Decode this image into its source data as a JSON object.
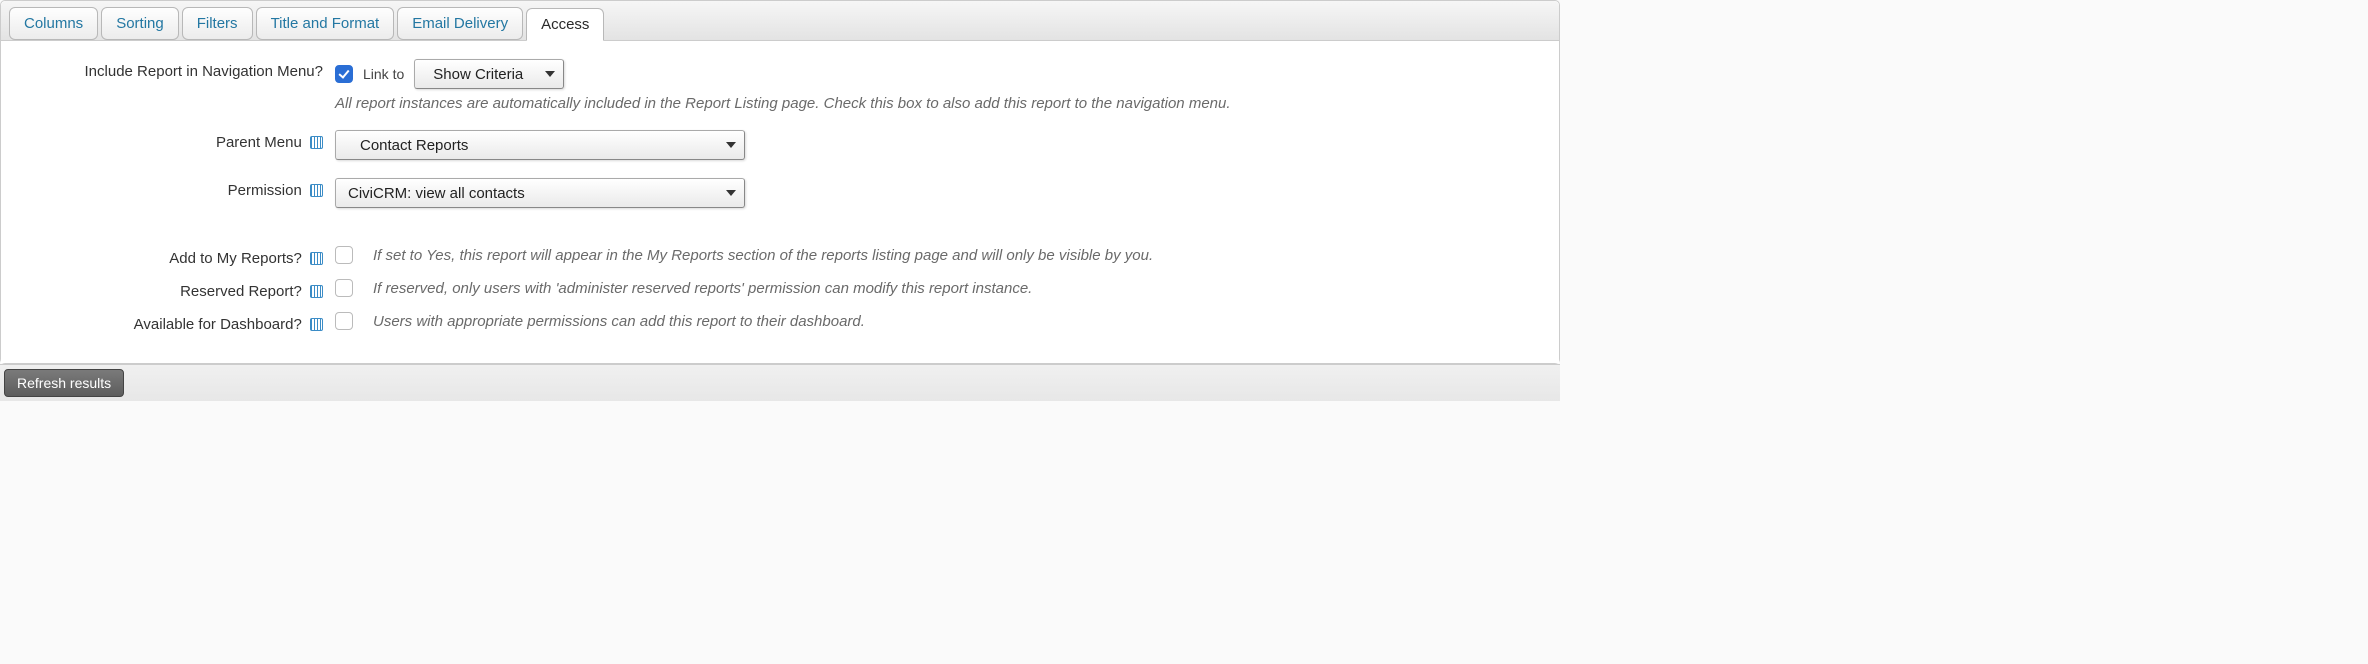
{
  "tabs": [
    {
      "label": "Columns"
    },
    {
      "label": "Sorting"
    },
    {
      "label": "Filters"
    },
    {
      "label": "Title and Format"
    },
    {
      "label": "Email Delivery"
    },
    {
      "label": "Access"
    }
  ],
  "access": {
    "include_nav": {
      "label": "Include Report in Navigation Menu?",
      "checked": true,
      "linkto_label": "Link to",
      "linkto_value": "Show Criteria",
      "hint": "All report instances are automatically included in the Report Listing page. Check this box to also add this report to the navigation menu."
    },
    "parent_menu": {
      "label": "Parent Menu",
      "value": "Contact Reports"
    },
    "permission": {
      "label": "Permission",
      "value": "CiviCRM: view all contacts"
    },
    "my_reports": {
      "label": "Add to My Reports?",
      "hint": "If set to Yes, this report will appear in the My Reports section of the reports listing page and will only be visible by you."
    },
    "reserved": {
      "label": "Reserved Report?",
      "hint": "If reserved, only users with 'administer reserved reports' permission can modify this report instance."
    },
    "dashboard": {
      "label": "Available for Dashboard?",
      "hint": "Users with appropriate permissions can add this report to their dashboard."
    }
  },
  "footer": {
    "refresh_label": "Refresh results"
  }
}
